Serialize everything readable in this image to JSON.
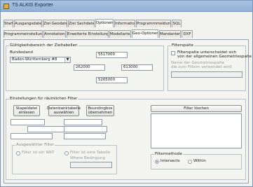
{
  "window": {
    "title": "TS ALKIS Exporter"
  },
  "tabs_row1": [
    "Start",
    "Ausgangsdaten",
    "Ziel Geodaten",
    "Ziel Sachdaten",
    "Optionen",
    "Information",
    "Programmmeldungen",
    "SQL"
  ],
  "tabs_row2": [
    "Programmeinstellungen",
    "Annotations",
    "Erweiterte Einstellungen",
    "Modellarten",
    "Geo-Optionen",
    "Mandanten",
    "DXF"
  ],
  "validity": {
    "legend": "Gültigkeitsbereich der Zieltabellen",
    "state_label": "Bundesland",
    "state_value": "Baden-Württemberg #8",
    "north": "5517000",
    "west": "262000",
    "east": "613000",
    "south": "5265000"
  },
  "filter_column": {
    "legend": "Filterspalte",
    "checkbox_label_1": "Filterspalte unterscheidet sich",
    "checkbox_label_2": "von der allgemeinen Geometriespalte",
    "name_label_1": "Name der Geometriespalte",
    "name_label_2": "die zum Filtern verwendet wird"
  },
  "spatial_filter": {
    "legend": "Einstellungen für räumlichen Filter",
    "btn_stapel": [
      "Stapeldatei",
      "einlesen"
    ],
    "btn_db": [
      "Datenbanktabelle",
      "auswählen"
    ],
    "btn_bbox": [
      "Boundingbox",
      "übernehmen"
    ],
    "btn_clear": "Filter löschen"
  },
  "selected_filter": {
    "legend": "Ausgewählter Filter",
    "radio_wkt": "Filter ist ein WKT",
    "radio_table": "Filter ist eine Tabelle",
    "where_label": "Where Bedingung"
  },
  "filter_method": {
    "legend": "Filtermethode",
    "option_intersects": "Intersects",
    "option_within": "Within"
  }
}
